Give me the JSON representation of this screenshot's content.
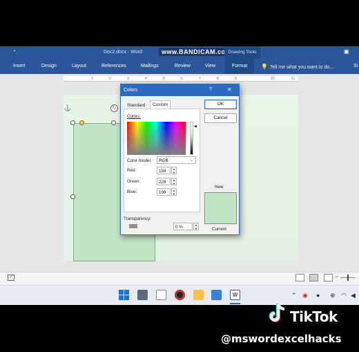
{
  "word": {
    "doc_title": "Doc2.docx - Word",
    "watermark": "www.BANDICAM.com",
    "contextual_group": "Drawing Tools",
    "tabs": [
      "Insert",
      "Design",
      "Layout",
      "References",
      "Mailings",
      "Review",
      "View",
      "Format"
    ],
    "active_tab": "Format",
    "tell_me_placeholder": "Tell me what you want to do...",
    "partial_tab": "Si",
    "ruler_marks": [
      "1",
      "2",
      "3",
      "4",
      "5",
      "6",
      "7",
      "8",
      "9",
      "10",
      "11"
    ]
  },
  "dialog": {
    "title": "Colors",
    "help": "?",
    "close": "✕",
    "tabs": [
      "Standard",
      "Custom"
    ],
    "active_tab": "Custom",
    "colors_label": "Colors:",
    "color_model_label": "Color model:",
    "color_model_value": "RGB",
    "red_label": "Red:",
    "red_value": "194",
    "green_label": "Green:",
    "green_value": "228",
    "blue_label": "Blue:",
    "blue_value": "198",
    "transparency_label": "Transparency:",
    "transparency_value": "0 %",
    "ok_label": "OK",
    "cancel_label": "Cancel",
    "new_label": "New",
    "current_label": "Current",
    "new_color": "#c2e4c6",
    "current_color": "#c2e4c6"
  },
  "overlay": {
    "brand": "TikTok",
    "handle": "@mswordexcelhacks"
  }
}
